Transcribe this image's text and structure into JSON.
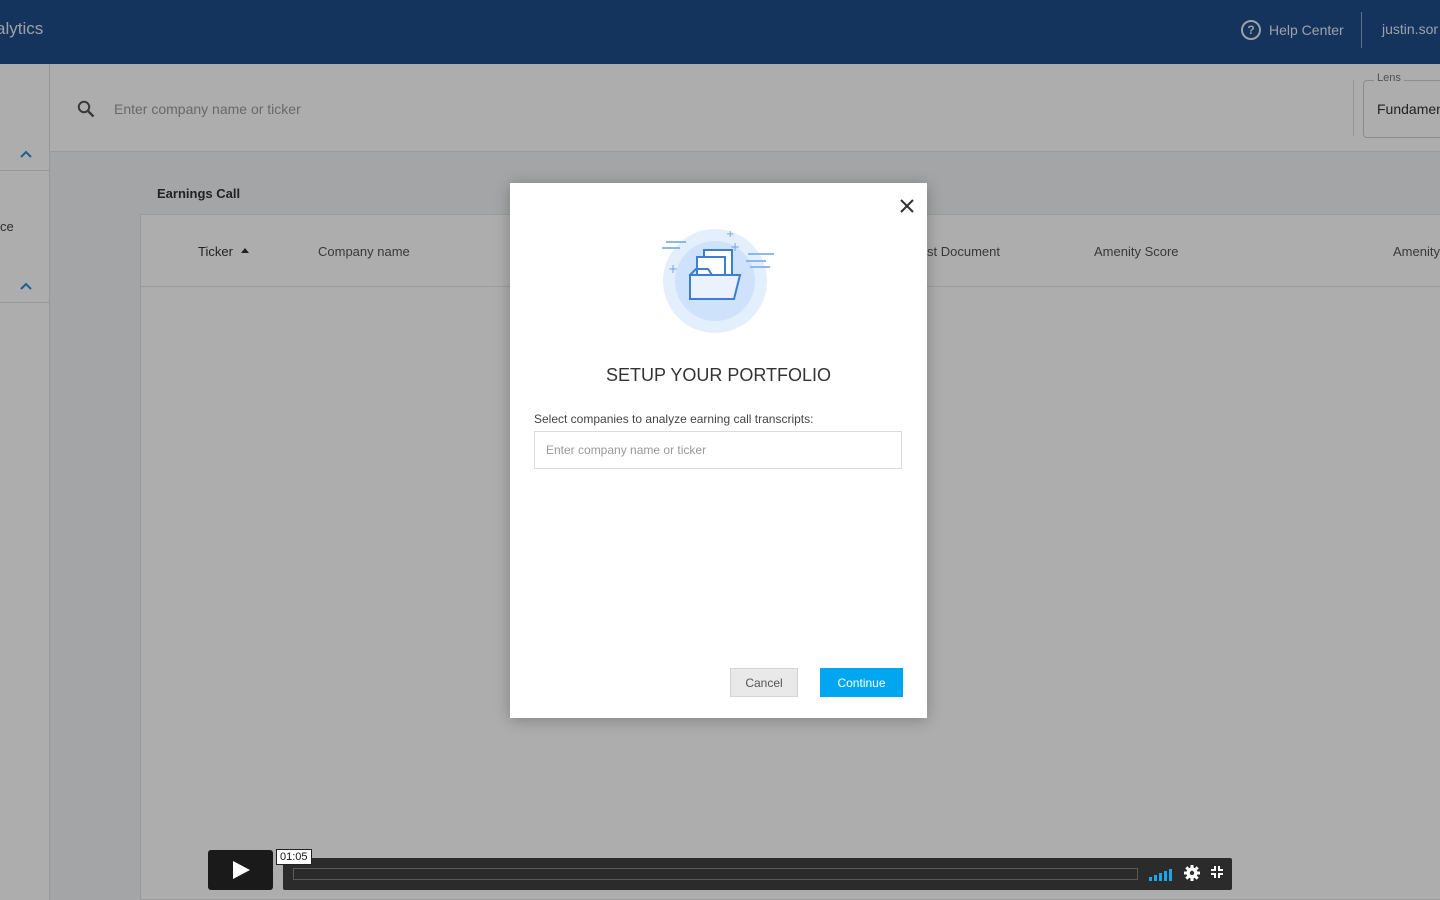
{
  "header": {
    "app_title": "alytics",
    "help_label": "Help Center",
    "user_label": "justin.sor"
  },
  "sidebar": {
    "partial_text": "ce"
  },
  "search": {
    "placeholder": "Enter company name or ticker"
  },
  "lens": {
    "label": "Lens",
    "value": "Fundamen"
  },
  "section": {
    "title": "Earnings Call"
  },
  "table": {
    "columns": [
      "Ticker",
      "Company name",
      "st Document",
      "Amenity Score",
      "Amenity"
    ]
  },
  "modal": {
    "title": "SETUP YOUR PORTFOLIO",
    "instruction": "Select companies to analyze earning call transcripts:",
    "input_placeholder": "Enter company name or ticker",
    "cancel_label": "Cancel",
    "continue_label": "Continue"
  },
  "player": {
    "time": "01:05"
  },
  "colors": {
    "topbar": "#1e4c8a",
    "accent": "#00a7f0",
    "sidebar_chevron": "#2a8fd6"
  },
  "icons": [
    "help-icon",
    "search-icon",
    "chevron-up-icon",
    "close-icon",
    "folder-documents-icon",
    "play-icon",
    "volume-icon",
    "gear-icon",
    "fullscreen-icon"
  ]
}
